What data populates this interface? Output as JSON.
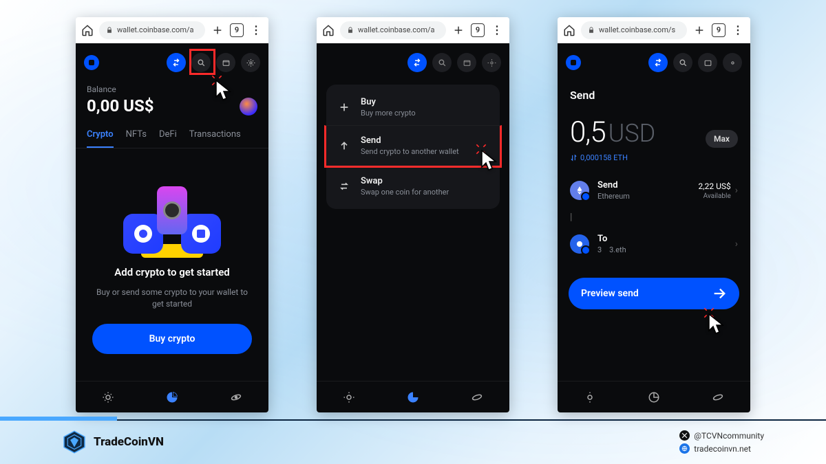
{
  "browser": {
    "url": "wallet.coinbase.com/a",
    "url3": "wallet.coinbase.com/s",
    "tab_count": "9"
  },
  "screen1": {
    "balance_label": "Balance",
    "balance_value": "0,00 US$",
    "tabs": {
      "crypto": "Crypto",
      "nfts": "NFTs",
      "defi": "DeFi",
      "tx": "Transactions"
    },
    "promo_title": "Add crypto to get started",
    "promo_sub": "Buy or send some crypto to your wallet to get started",
    "buy_label": "Buy crypto"
  },
  "screen2": {
    "buy": {
      "title": "Buy",
      "sub": "Buy more crypto"
    },
    "send": {
      "title": "Send",
      "sub": "Send crypto to another wallet"
    },
    "swap": {
      "title": "Swap",
      "sub": "Swap one coin for another"
    }
  },
  "screen3": {
    "title": "Send",
    "amount_num": "0,5",
    "amount_currency": "USD",
    "max": "Max",
    "convert": "0,000158 ETH",
    "send_label": "Send",
    "send_coin": "Ethereum",
    "send_usd": "2,22 US$",
    "send_avail": "Available",
    "to_label": "To",
    "to_left": "3",
    "to_right": "3.eth",
    "preview": "Preview send"
  },
  "footer": {
    "brand": "TradeCoinVN",
    "twitter": "@TCVNcommunity",
    "site": "tradecoinvn.net"
  }
}
